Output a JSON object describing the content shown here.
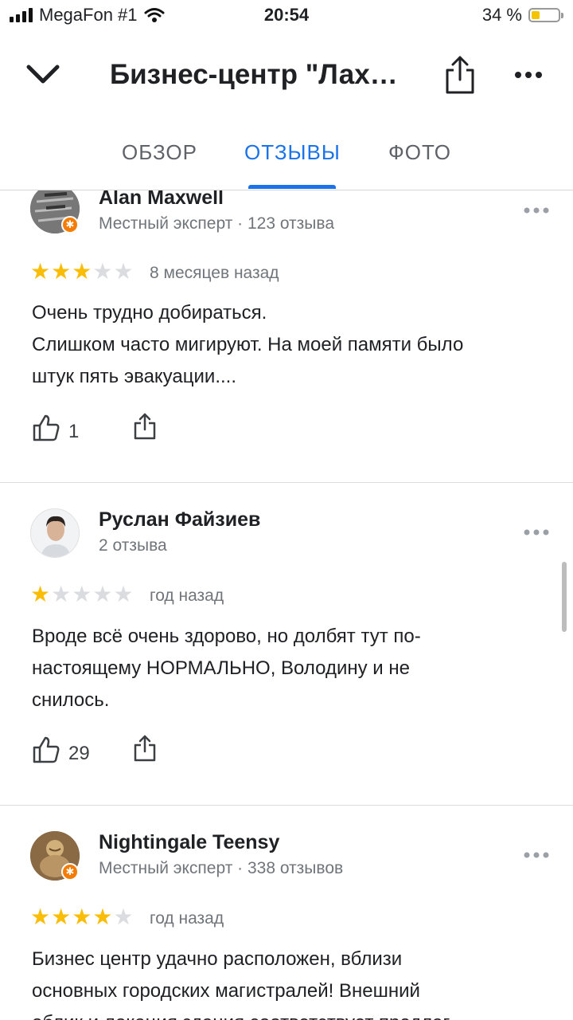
{
  "status_bar": {
    "carrier": "MegaFon #1",
    "time": "20:54",
    "battery": "34 %"
  },
  "header": {
    "title": "Бизнес-центр \"Лах…"
  },
  "tabs": [
    {
      "label": "ОБЗОР",
      "active": false
    },
    {
      "label": "ОТЗЫВЫ",
      "active": true
    },
    {
      "label": "ФОТО",
      "active": false
    }
  ],
  "reviews": [
    {
      "author": "Alan Maxwell",
      "meta": "Местный эксперт · 123 отзыва",
      "rating": 3,
      "date": "8 месяцев назад",
      "text_lines": [
        "Очень трудно добираться.",
        "Слишком часто мигируют. На моей памяти было",
        "штук пять эвакуации...."
      ],
      "likes": "1"
    },
    {
      "author": "Руслан Файзиев",
      "meta": "2 отзыва",
      "rating": 1,
      "date": "год назад",
      "text_lines": [
        "Вроде всё очень здорово, но долбят тут по-",
        "настоящему НОРМАЛЬНО, Володину и не",
        "снилось."
      ],
      "likes": "29"
    },
    {
      "author": "Nightingale Teensy",
      "meta": "Местный эксперт · 338 отзывов",
      "rating": 4,
      "date": "год назад",
      "text_lines": [
        "Бизнес центр удачно расположен, вблизи",
        "основных городских магистралей! Внешний",
        "облик и локация здания соответствует предлаг"
      ]
    }
  ],
  "colors": {
    "accent": "#1a73e8",
    "star": "#fbbc04",
    "badge": "#f57c00"
  }
}
